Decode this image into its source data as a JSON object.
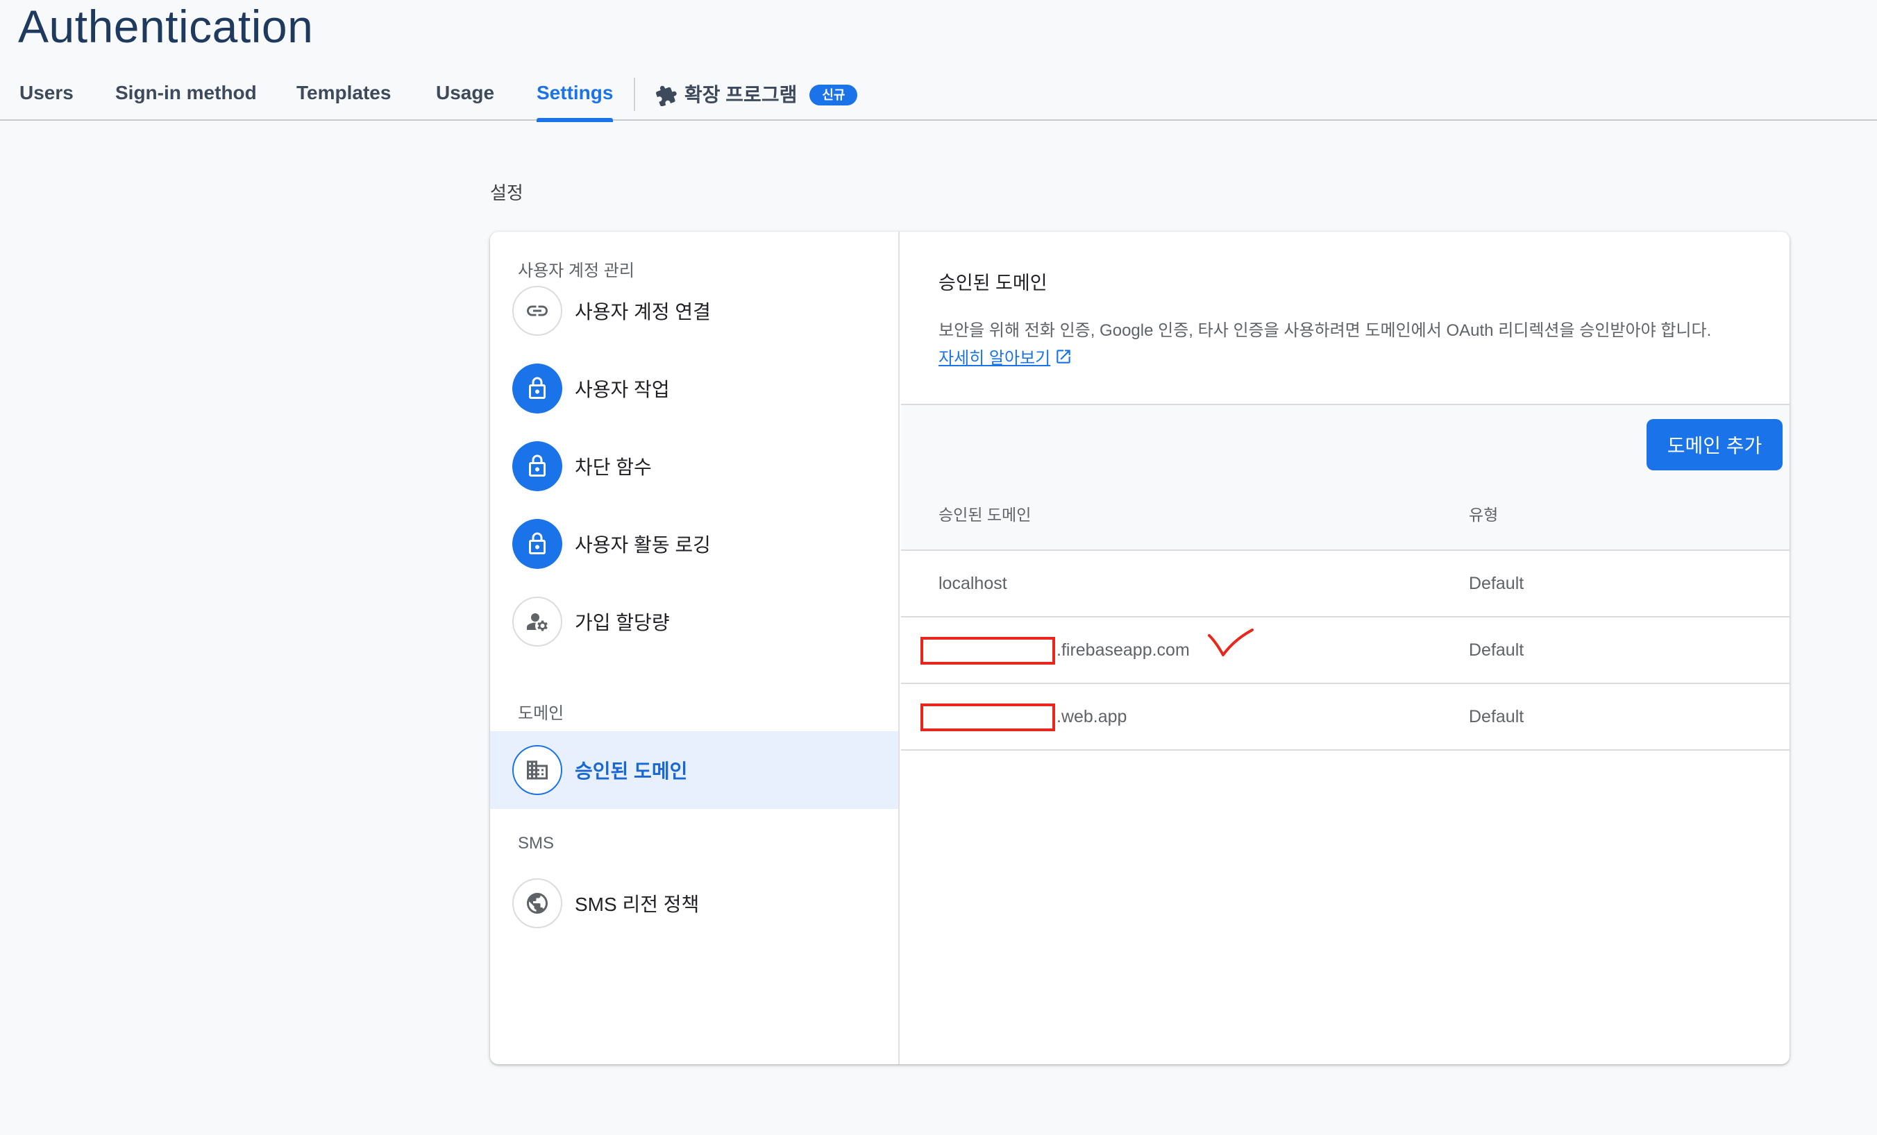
{
  "page": {
    "title": "Authentication"
  },
  "tabs": [
    {
      "label": "Users",
      "active": false
    },
    {
      "label": "Sign-in method",
      "active": false
    },
    {
      "label": "Templates",
      "active": false
    },
    {
      "label": "Usage",
      "active": false
    },
    {
      "label": "Settings",
      "active": true
    }
  ],
  "extensions_tab": {
    "label": "확장 프로그램",
    "badge": "신규",
    "icon": "puzzle-icon"
  },
  "section_heading": "설정",
  "sidebar": {
    "groups": [
      {
        "label": "사용자 계정 관리",
        "items": [
          {
            "label": "사용자 계정 연결",
            "icon": "link-icon"
          },
          {
            "label": "사용자 작업",
            "icon": "lock-icon"
          },
          {
            "label": "차단 함수",
            "icon": "lock-icon"
          },
          {
            "label": "사용자 활동 로깅",
            "icon": "lock-icon"
          },
          {
            "label": "가입 할당량",
            "icon": "manage-account-icon"
          }
        ]
      },
      {
        "label": "도메인",
        "items": [
          {
            "label": "승인된 도메인",
            "icon": "building-icon",
            "selected": true
          }
        ]
      },
      {
        "label": "SMS",
        "items": [
          {
            "label": "SMS 리전 정책",
            "icon": "globe-icon"
          }
        ]
      }
    ]
  },
  "main": {
    "title": "승인된 도메인",
    "description": "보안을 위해 전화 인증, Google 인증, 타사 인증을 사용하려면 도메인에서 OAuth 리디렉션을 승인받아야 합니다.",
    "learn_more": "자세히 알아보기",
    "add_button": "도메인 추가",
    "table": {
      "columns": [
        "승인된 도메인",
        "유형"
      ],
      "rows": [
        {
          "domain": "localhost",
          "type": "Default",
          "redacted": false
        },
        {
          "domain": ".firebaseapp.com",
          "type": "Default",
          "redacted": true
        },
        {
          "domain": ".web.app",
          "type": "Default",
          "redacted": true
        }
      ]
    }
  },
  "colors": {
    "accent": "#1a73e8",
    "title": "#1f3a5f",
    "redaction": "#e8261b"
  }
}
